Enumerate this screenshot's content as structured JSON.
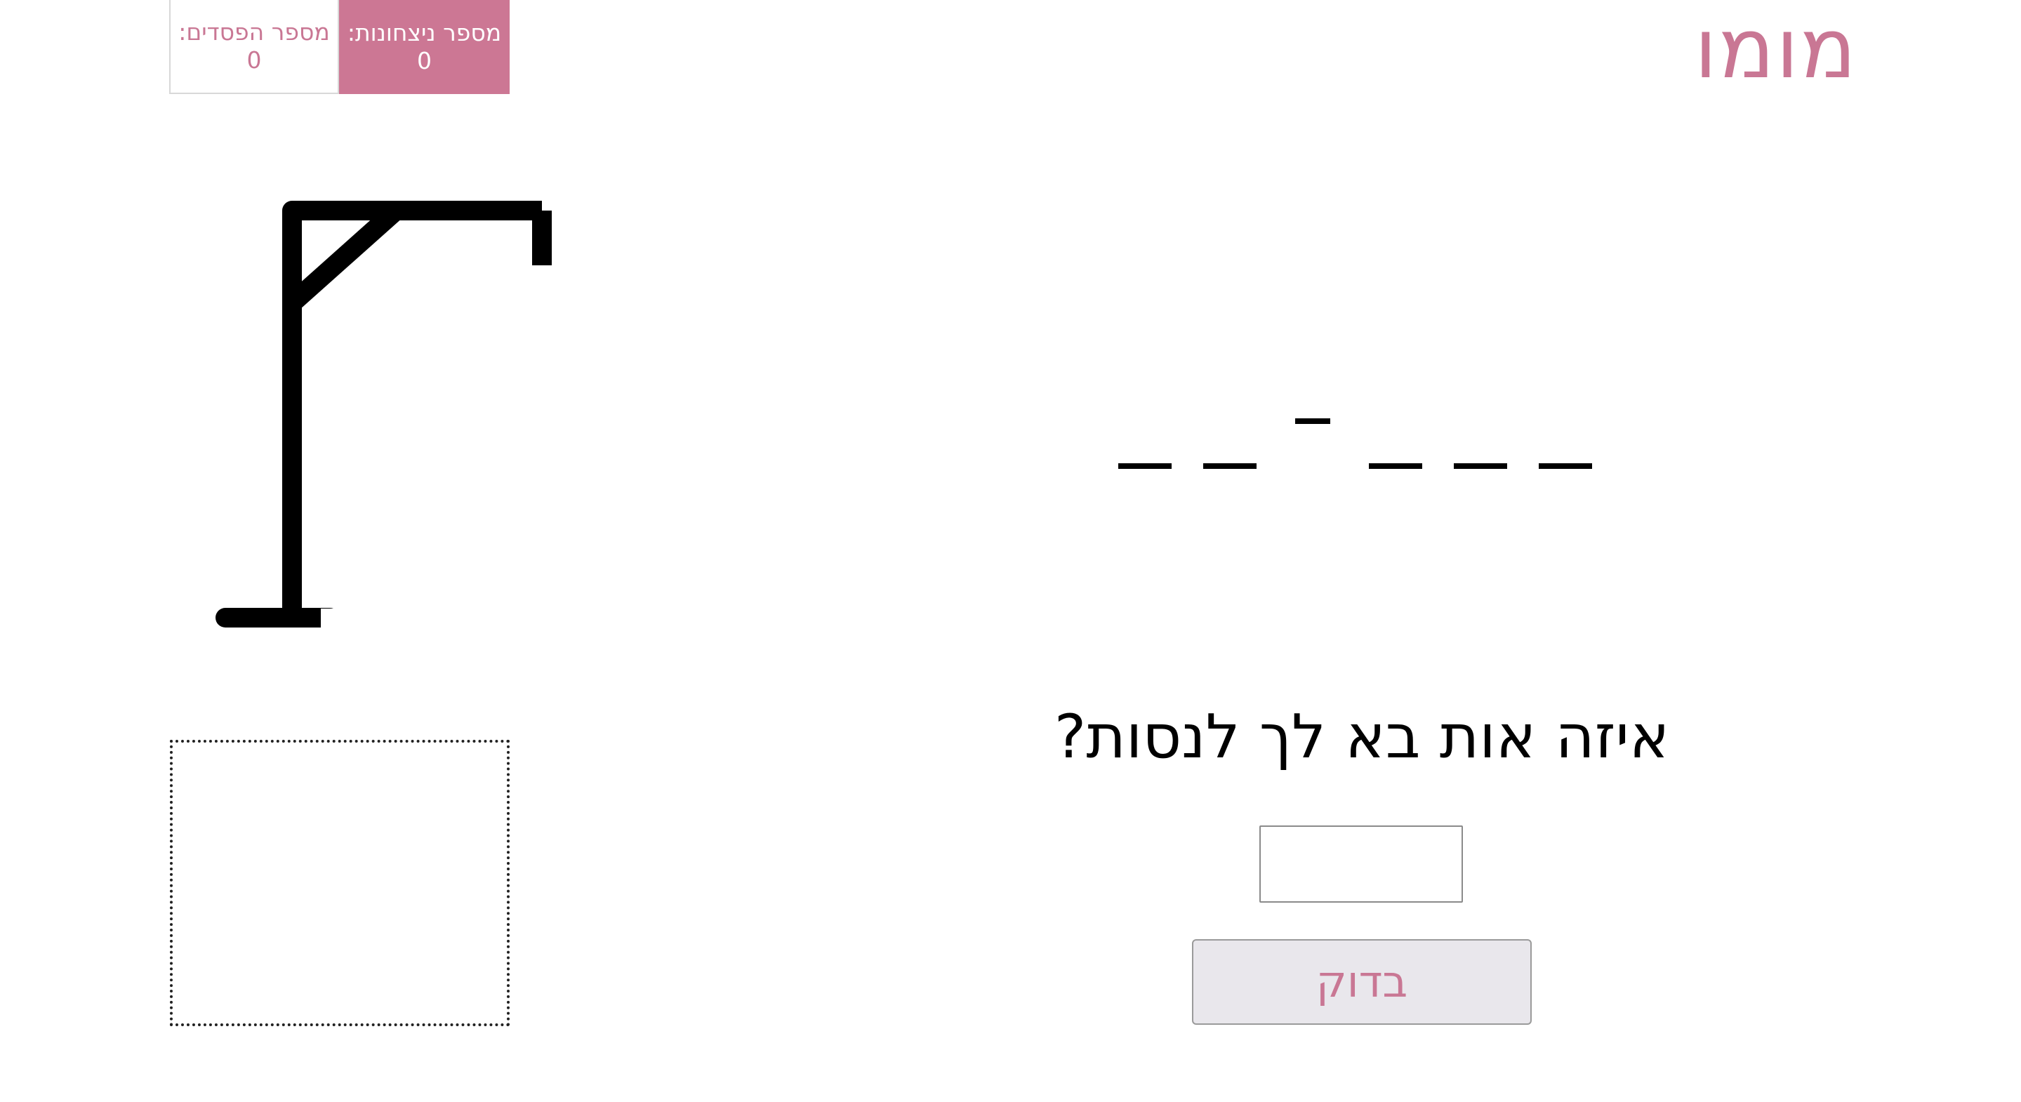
{
  "logo": {
    "text": "מומו",
    "color": "#c97794"
  },
  "scores": {
    "wins": {
      "label": "מספר ניצחונות:",
      "value": "0",
      "bg": "#cc7794"
    },
    "losses": {
      "label": "מספר הפסדים:",
      "value": "0"
    }
  },
  "word": {
    "slots": [
      "blank",
      "blank",
      "blank",
      "dash",
      "blank",
      "blank"
    ]
  },
  "prompt": {
    "text": "איזה אות בא לך לנסות?"
  },
  "guess_input": {
    "value": "",
    "placeholder": ""
  },
  "check_button": {
    "label": "בדוק"
  },
  "used_letters": {
    "text": ""
  },
  "colors": {
    "accent": "#c97794",
    "button_bg": "#e9e7ec",
    "text": "#000000"
  }
}
